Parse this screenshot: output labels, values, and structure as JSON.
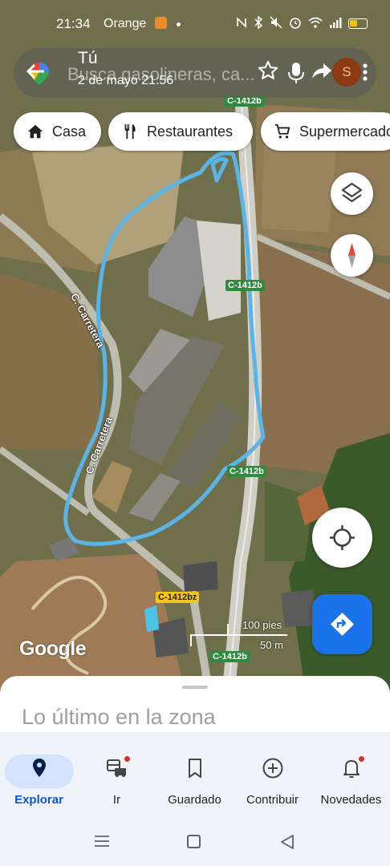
{
  "status_bar": {
    "time": "21:34",
    "carrier": "Orange",
    "icons": [
      "nfc-icon",
      "bluetooth-icon",
      "mute-icon",
      "alarm-icon",
      "wifi-icon",
      "signal-icon",
      "battery-icon"
    ]
  },
  "search": {
    "placeholder": "Busca gasolineras, ca...",
    "title": "Tú",
    "subtitle": "2 de mayo 21:56",
    "avatar_letter": "S"
  },
  "chips": [
    {
      "label": "Casa",
      "icon": "home-icon"
    },
    {
      "label": "Restaurantes",
      "icon": "restaurant-icon"
    },
    {
      "label": "Supermercado",
      "icon": "cart-icon"
    }
  ],
  "map": {
    "road_labels": [
      "C-1412b",
      "C-1412b",
      "C-1412b",
      "C-1412bz",
      "C-1412b"
    ],
    "street_labels": [
      "C. Carretera",
      "C. Carretera"
    ],
    "track_color": "#5ab4e6",
    "google_logo": "Google",
    "scale_imperial": "100 pies",
    "scale_metric": "50 m"
  },
  "sheet": {
    "title": "Lo último en la zona"
  },
  "nav": {
    "items": [
      {
        "label": "Explorar",
        "icon": "location-pin-icon",
        "active": true
      },
      {
        "label": "Ir",
        "icon": "commute-icon",
        "badge": true
      },
      {
        "label": "Guardado",
        "icon": "bookmark-icon"
      },
      {
        "label": "Contribuir",
        "icon": "add-circle-icon"
      },
      {
        "label": "Novedades",
        "icon": "bell-icon",
        "badge": true
      }
    ]
  },
  "colors": {
    "accent": "#0b57d0",
    "directions_button": "#1a73e8",
    "road_label_green": "#2e8b3e",
    "road_label_yellow": "#f5c518"
  }
}
